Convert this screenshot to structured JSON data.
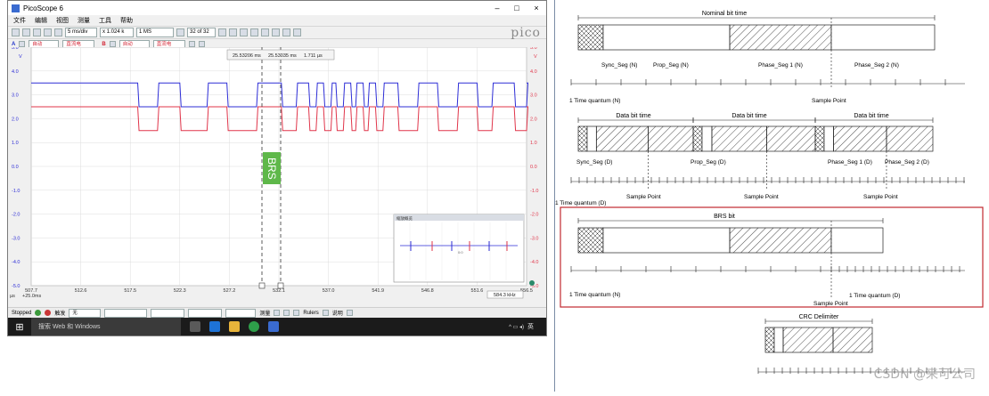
{
  "app": {
    "title": "PicoScope 6",
    "window_controls": [
      "–",
      "□",
      "×"
    ],
    "menu": [
      "文件",
      "编辑",
      "视图",
      "测量",
      "工具",
      "帮助"
    ],
    "toolbar": {
      "timebase": "5 ms/div",
      "zoom": "x 1.024 k",
      "samples": "1 MS",
      "buffer": "32 of 32"
    },
    "logo": "pico",
    "channels": {
      "a_label": "A",
      "a_range": "自动",
      "a_coupling": "直流电",
      "b_label": "B",
      "b_range": "自动",
      "b_coupling": "直流电"
    },
    "colors": {
      "ch_a": "#2d2dd6",
      "ch_b": "#e0354a",
      "brs_marker": "#5fb84a"
    },
    "ruler_readout": {
      "t1": "25.53206 ms",
      "t2": "25.53035 ms",
      "delta": "1.711 µs"
    },
    "marker_label": "BRS",
    "left_axis": {
      "unit": "V",
      "ticks": [
        "5.0",
        "4.0",
        "3.0",
        "2.0",
        "1.0",
        "0.0",
        "-1.0",
        "-2.0",
        "-3.0",
        "-4.0",
        "-5.0"
      ]
    },
    "right_axis": {
      "unit": "V",
      "ticks": [
        "5.0",
        "4.0",
        "3.0",
        "2.0",
        "1.0",
        "0.0",
        "-1.0",
        "-2.0",
        "-3.0",
        "-4.0",
        "-5.0"
      ]
    },
    "x_axis": {
      "ticks": [
        "507.7",
        "512.6",
        "517.5",
        "522.3",
        "527.2",
        "532.1",
        "537.0",
        "541.9",
        "546.8",
        "551.6",
        "556.5"
      ],
      "unit": "µs",
      "offset": "+25.0ms"
    },
    "freq_readout": "584.3 kHz",
    "overview_title": "缩放概览",
    "overview_center": "0:0",
    "status": {
      "state": "Stopped",
      "trigger_label": "触发",
      "trigger_mode": "无",
      "measure_label": "测量",
      "rulers_label": "Rulers",
      "notes_label": "说明"
    },
    "taskbar": {
      "search": "搜索 Web 和 Windows",
      "time": "英"
    }
  },
  "diagram": {
    "sections": [
      {
        "title": "Nominal bit time",
        "segments": [
          "Sync_Seg (N)",
          "Prop_Seg (N)",
          "Phase_Seg 1 (N)",
          "Phase_Seg 2 (N)"
        ],
        "tq_label": "1 Time quantum (N)",
        "sample_label": "Sample Point"
      },
      {
        "titles": [
          "Data bit time",
          "Data bit time",
          "Data bit time"
        ],
        "segments": [
          "Sync_Seg (D)",
          "Prop_Seg (D)",
          "Phase_Seg 1 (D)",
          "Phase_Seg 2 (D)"
        ],
        "tq_label": "1 Time quantum (D)",
        "sample_labels": [
          "Sample Point",
          "Sample Point",
          "Sample Point"
        ]
      },
      {
        "title": "BRS bit",
        "tq_n_label": "1 Time quantum (N)",
        "tq_d_label": "1 Time quantum (D)",
        "sample_label": "Sample Point"
      },
      {
        "title": "CRC Delimiter"
      }
    ],
    "highlight_color": "#c0282f",
    "watermark": "CSDN @来可公司"
  }
}
